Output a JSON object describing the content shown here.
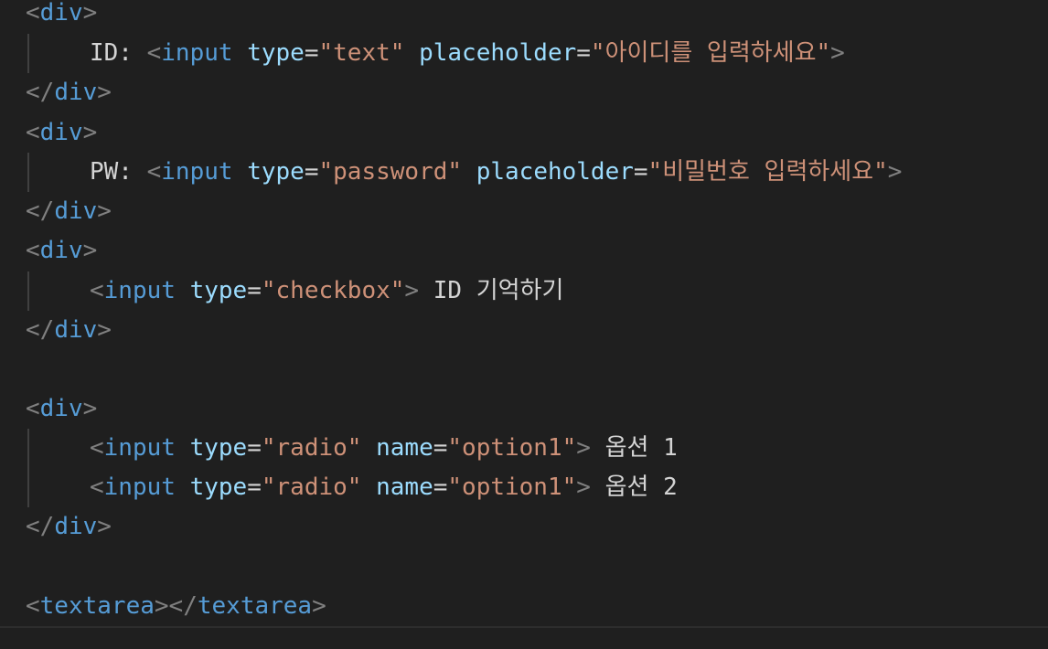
{
  "theme": {
    "background": "#1f1f1f",
    "tag": "#569cd6",
    "bracket": "#808080",
    "attribute": "#9cdcfe",
    "string": "#ce9178",
    "text": "#d4d4d4"
  },
  "code": {
    "tag_div": "div",
    "tag_input": "input",
    "tag_textarea": "textarea",
    "attr_type": "type",
    "attr_placeholder": "placeholder",
    "attr_name": "name",
    "eq": "=",
    "open": "<",
    "close": ">",
    "close_open": "</",
    "line2_label": "ID: ",
    "line2_type_value": "\"text\"",
    "line2_placeholder_value": "\"아이디를 입력하세요\"",
    "line5_label": "PW: ",
    "line5_type_value": "\"password\"",
    "line5_placeholder_value": "\"비밀번호 입력하세요\"",
    "line8_type_value": "\"checkbox\"",
    "line8_text": " ID 기억하기",
    "line12_type_value": "\"radio\"",
    "line12_name_value": "\"option1\"",
    "line12_text": " 옵션 1",
    "line13_type_value": "\"radio\"",
    "line13_name_value": "\"option1\"",
    "line13_text": " 옵션 2"
  }
}
